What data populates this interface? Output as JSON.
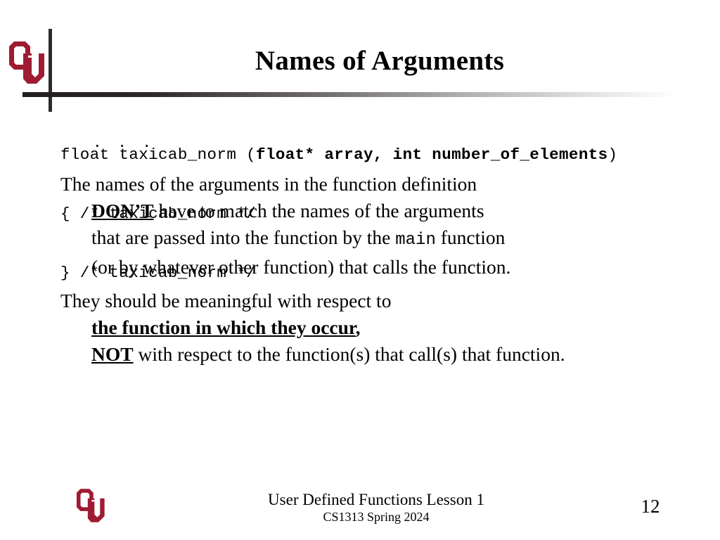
{
  "slide": {
    "title": "Names of Arguments",
    "page_number": "12",
    "brand_color": "#9E1B32",
    "rule_color": "#231F20"
  },
  "logo": {
    "alt": "ou-logo",
    "letters": "OU"
  },
  "code": {
    "line1_plain_start": "float taxicab_norm (",
    "line1_bold": "float* array, int number_of_elements",
    "line1_plain_end": ")",
    "line2": "{ /* taxicab_norm */",
    "ellipsis": ". . .",
    "line3": "} /* taxicab_norm */"
  },
  "body": {
    "paragraph1": {
      "line1": "The names of the arguments in the function definition",
      "line2_emphasis": "DON’T",
      "line2_rest": " have to match the names of the arguments",
      "line3_pre": "that are passed into the function by the ",
      "line3_mono": "main",
      "line3_post": " function",
      "line4": "(or by whatever other function) that calls the function."
    },
    "paragraph2": {
      "line1": "They should be meaningful with respect to",
      "line2_emphasis": "the function in which they occur",
      "line2_rest": ",",
      "line3_emphasis": "NOT",
      "line3_rest": " with respect to the function(s) that call(s) that function."
    }
  },
  "footer": {
    "line1": "User Defined Functions Lesson 1",
    "line2": "CS1313 Spring 2024"
  }
}
